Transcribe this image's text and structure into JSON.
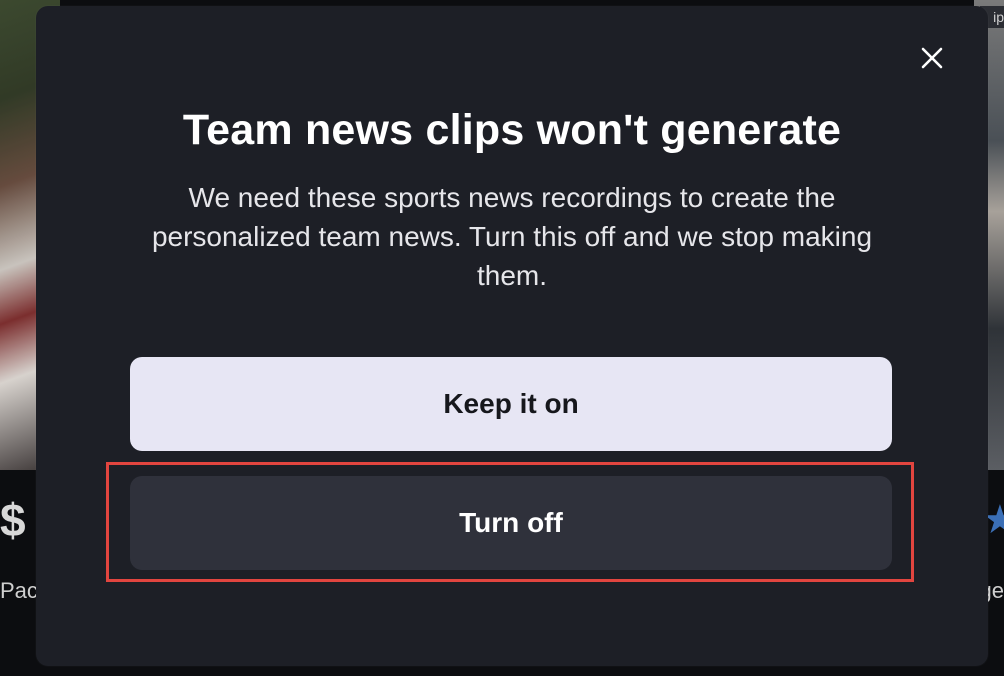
{
  "dialog": {
    "title": "Team news clips won't generate",
    "description": "We need these sports news recordings to create the personalized team news. Turn this off and we stop making them.",
    "close_icon": "close-icon",
    "buttons": {
      "keep_label": "Keep it on",
      "turn_off_label": "Turn off"
    }
  },
  "background": {
    "left_text": "Pac",
    "right_text": "ge",
    "right_tag": "ip"
  },
  "colors": {
    "modal_bg": "#1d1f26",
    "primary_button_bg": "#e7e6f4",
    "secondary_button_bg": "#2f313b",
    "highlight_border": "#e2453f"
  }
}
